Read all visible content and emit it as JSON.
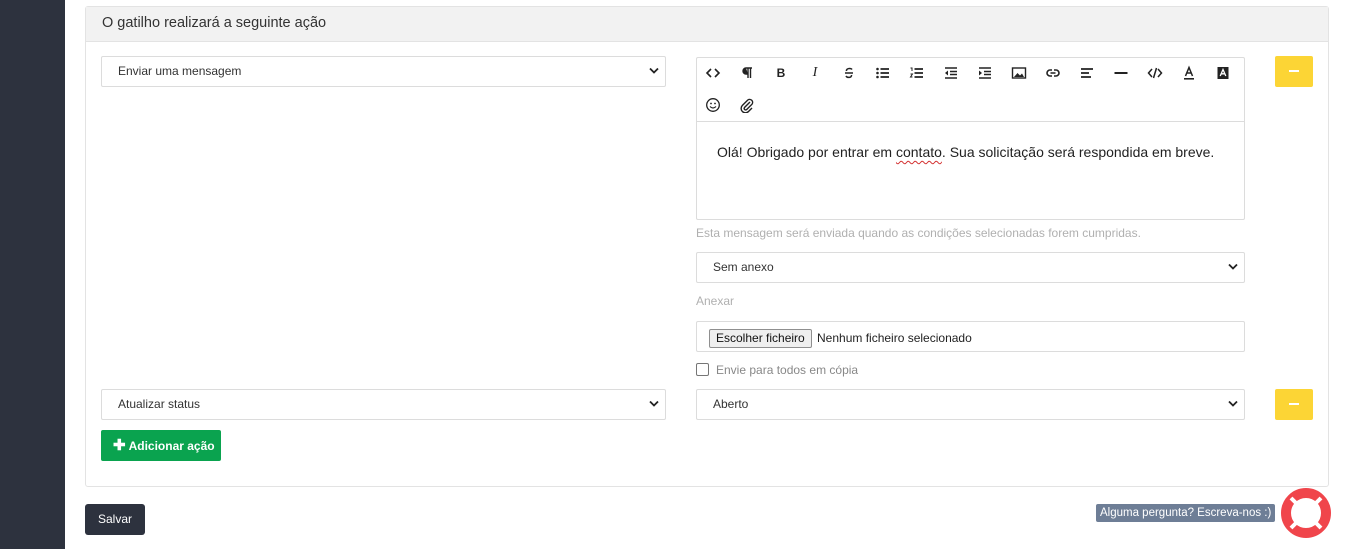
{
  "section_title": "O gatilho realizará a seguinte ação",
  "actions": [
    {
      "type": "Enviar uma mensagem"
    },
    {
      "type": "Atualizar status",
      "value": "Aberto"
    }
  ],
  "editor": {
    "toolbar_icons": [
      "code-view-icon",
      "paragraph-icon",
      "bold-icon",
      "italic-icon",
      "strikethrough-icon",
      "unordered-list-icon",
      "ordered-list-icon",
      "outdent-icon",
      "indent-icon",
      "image-icon",
      "link-icon",
      "align-icon",
      "horizontal-rule-icon",
      "code-icon",
      "font-color-icon",
      "background-color-icon",
      "emoji-icon",
      "attachment-icon"
    ],
    "content_before": "Olá! Obrigado por entrar em ",
    "content_misspelled": "contato",
    "content_after": ". Sua solicitação será respondida em breve."
  },
  "help_text": "Esta mensagem será enviada quando as condições selecionadas forem cumpridas.",
  "attachment_select": "Sem anexo",
  "attachment_label": "Anexar",
  "file_input": {
    "button": "Escolher ficheiro",
    "status": "Nenhum ficheiro selecionado"
  },
  "cc_checkbox_label": "Envie para todos em cópia",
  "add_action_label": "Adicionar ação",
  "save_label": "Salvar",
  "chat_prompt": "Alguma pergunta? Escreva-nos :)",
  "colors": {
    "sidebar": "#2d323e",
    "minus": "#fcd535",
    "add": "#0aa34f",
    "lifebuoy": "#f0454b"
  }
}
